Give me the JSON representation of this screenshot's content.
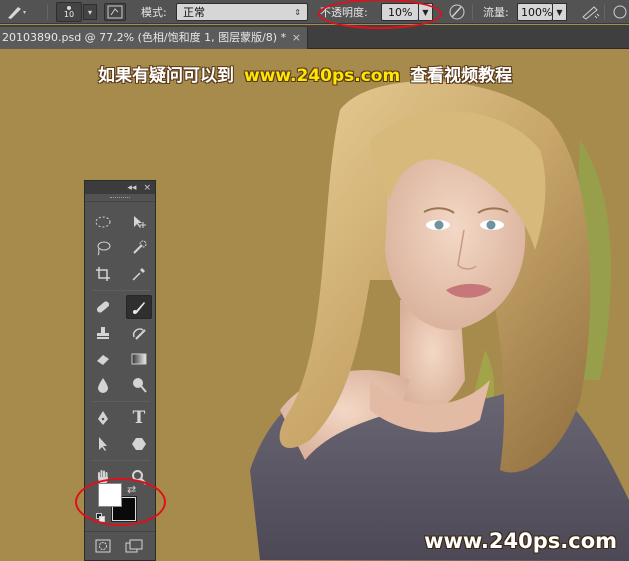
{
  "options_bar": {
    "brush_size": "10",
    "mode_label": "模式:",
    "mode_value": "正常",
    "opacity_label": "不透明度:",
    "opacity_value": "10%",
    "flow_label": "流量:",
    "flow_value": "100%"
  },
  "document_tab": {
    "title": "20103890.psd @ 77.2% (色相/饱和度 1, 图层蒙版/8) *",
    "close": "×"
  },
  "canvas": {
    "banner_left": "如果有疑问可以到",
    "banner_url": "www.240ps.com",
    "banner_right": "查看视频教程",
    "watermark": "www.240ps.com"
  },
  "tools_panel": {
    "collapse": "◂◂",
    "close": "×",
    "tools": [
      [
        "marquee-icon",
        "move-icon"
      ],
      [
        "lasso-icon",
        "quick-selection-icon"
      ],
      [
        "crop-icon",
        "eyedropper-icon"
      ],
      [
        "healing-brush-icon",
        "brush-icon"
      ],
      [
        "clone-stamp-icon",
        "history-brush-icon"
      ],
      [
        "eraser-icon",
        "gradient-icon"
      ],
      [
        "blur-icon",
        "dodge-icon"
      ],
      [
        "pen-icon",
        "type-icon"
      ],
      [
        "path-selection-icon",
        "shape-icon"
      ],
      [
        "hand-icon",
        "zoom-icon"
      ]
    ],
    "active_tool": "brush-icon",
    "foreground_color": "#ffffff",
    "background_color": "#0a0a0a"
  },
  "colors": {
    "canvas_bg": "#a68b4d",
    "highlight_ring": "#e0101a"
  }
}
